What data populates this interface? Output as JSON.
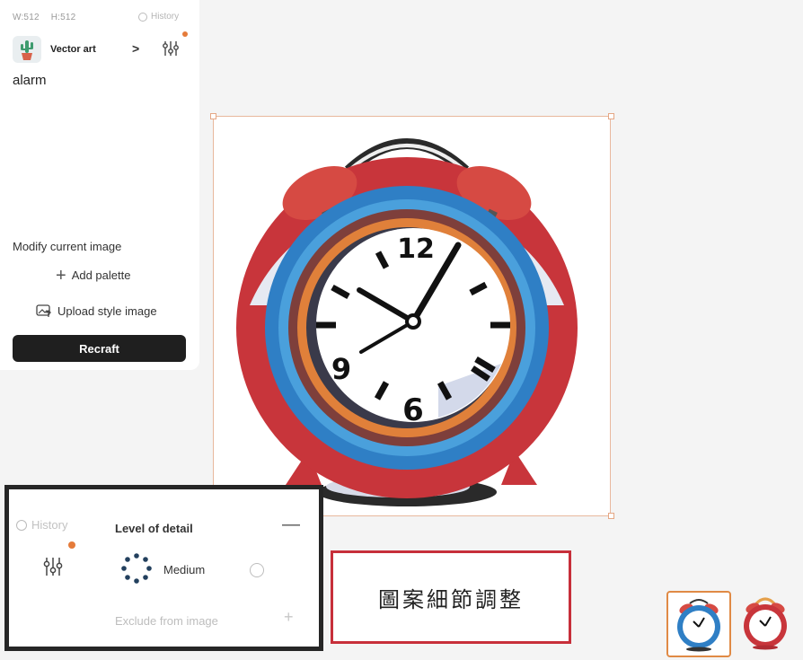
{
  "panel": {
    "width_label": "W:512",
    "height_label": "H:512",
    "history_label": "History",
    "style": {
      "name": "Vector art",
      "chevron": ">"
    },
    "prompt": "alarm",
    "modify_label": "Modify current image",
    "add_palette_label": "Add palette",
    "upload_style_label": "Upload style image",
    "recraft_label": "Recraft"
  },
  "inset": {
    "history_label": "History",
    "level_of_detail_label": "Level of detail",
    "level_value": "Medium",
    "exclude_placeholder": "Exclude from image"
  },
  "annotation": {
    "text": "圖案細節調整"
  },
  "clock_numbers": {
    "twelve": "12",
    "nine": "9",
    "six": "6"
  },
  "colors": {
    "accent": "#e57b3a",
    "annotation_border": "#c72f3a",
    "button_bg": "#1f1f1f",
    "selection_border": "#e8b89d"
  },
  "icons": {
    "history": "clock-icon",
    "tune": "sliders-icon",
    "add_palette": "plus-icon",
    "upload": "image-upload-icon",
    "collapse": "minus-icon",
    "exclude_add": "plus-icon"
  }
}
